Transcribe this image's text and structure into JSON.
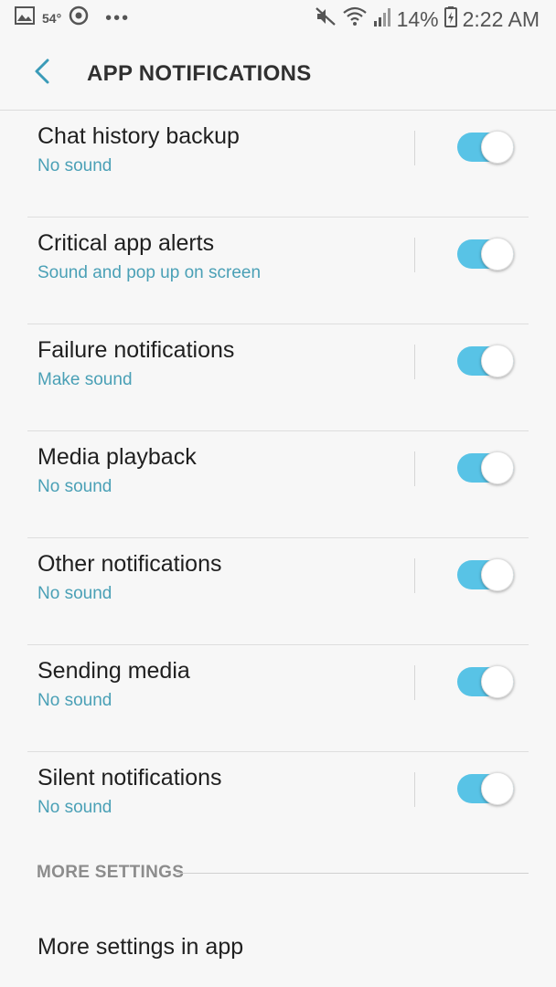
{
  "status_bar": {
    "temperature": "54°",
    "more_dots": "•••",
    "battery_percent": "14%",
    "time": "2:22 AM",
    "icons": [
      "image-icon",
      "chrome-icon",
      "mute-icon",
      "wifi-icon",
      "signal-icon",
      "battery-icon"
    ]
  },
  "header": {
    "title": "APP NOTIFICATIONS",
    "back_icon": "back-chevron-icon"
  },
  "accent_color": "#4aa0b6",
  "toggle_on_color": "#58c3e6",
  "notifications": [
    {
      "label": "Chat history backup",
      "sub": "No sound",
      "enabled": true
    },
    {
      "label": "Critical app alerts",
      "sub": "Sound and pop up on screen",
      "enabled": true
    },
    {
      "label": "Failure notifications",
      "sub": "Make sound",
      "enabled": true
    },
    {
      "label": "Media playback",
      "sub": "No sound",
      "enabled": true
    },
    {
      "label": "Other notifications",
      "sub": "No sound",
      "enabled": true
    },
    {
      "label": "Sending media",
      "sub": "No sound",
      "enabled": true
    },
    {
      "label": "Silent notifications",
      "sub": "No sound",
      "enabled": true
    }
  ],
  "more_settings": {
    "section_label": "MORE SETTINGS",
    "item_label": "More settings in app"
  }
}
